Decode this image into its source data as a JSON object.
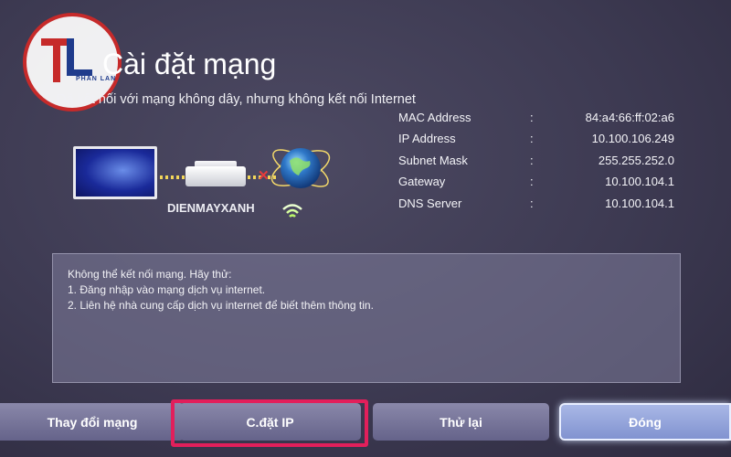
{
  "logo": {
    "letters": "TL",
    "sub_label": "PHAN LAN",
    "colors": {
      "ring": "#c62a2a",
      "letter_t": "#c62a2a",
      "letter_l": "#1f3b8c"
    }
  },
  "header": {
    "title": "Cài đặt mạng",
    "subtitle": "Đã kết nối với mạng không dây, nhưng không kết nối Internet"
  },
  "diagram": {
    "router_name": "DIENMAYXANH",
    "icons": [
      "tv-icon",
      "router-icon",
      "disconnect-icon",
      "globe-icon",
      "wifi-icon"
    ]
  },
  "network_info": [
    {
      "label": "MAC Address",
      "colon": ":",
      "value": "84:a4:66:ff:02:a6"
    },
    {
      "label": "IP Address",
      "colon": ":",
      "value": "10.100.106.249"
    },
    {
      "label": "Subnet Mask",
      "colon": ":",
      "value": "255.255.252.0"
    },
    {
      "label": "Gateway",
      "colon": ":",
      "value": "10.100.104.1"
    },
    {
      "label": "DNS Server",
      "colon": ":",
      "value": "10.100.104.1"
    }
  ],
  "message": {
    "lines": [
      "Không thể kết nối mạng. Hãy thử:",
      "1. Đăng nhập vào mạng dịch vụ internet.",
      "2. Liên hệ nhà cung cấp dịch vụ internet để biết thêm thông tin."
    ]
  },
  "buttons": {
    "change_network": "Thay đổi mạng",
    "ip_settings": "C.đặt IP",
    "retry": "Thử lại",
    "close": "Đóng"
  },
  "colors": {
    "background": "#3d3a52",
    "highlight_frame": "#e21f5b",
    "focused_button": "#a9b8e6",
    "link_dots": "#f2d65a",
    "disconnect_mark": "#e63b3b"
  }
}
